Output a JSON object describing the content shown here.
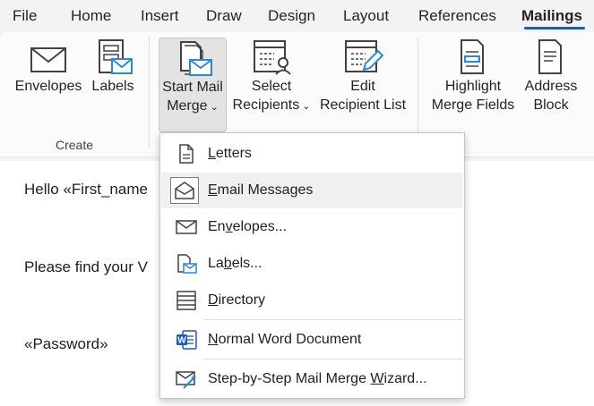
{
  "tabs": [
    {
      "label": "File"
    },
    {
      "label": "Home"
    },
    {
      "label": "Insert"
    },
    {
      "label": "Draw"
    },
    {
      "label": "Design"
    },
    {
      "label": "Layout"
    },
    {
      "label": "References"
    },
    {
      "label": "Mailings",
      "active": true
    }
  ],
  "ribbon": {
    "create_group": {
      "label": "Create",
      "envelopes": "Envelopes",
      "labels": "Labels"
    },
    "start_mail_merge": {
      "line1": "Start Mail",
      "line2": "Merge"
    },
    "select_recipients": {
      "line1": "Select",
      "line2": "Recipients"
    },
    "edit_recipient_list": {
      "line1": "Edit",
      "line2": "Recipient List"
    },
    "highlight_merge_fields": {
      "line1": "Highlight",
      "line2": "Merge Fields"
    },
    "address_block": {
      "line1": "Address",
      "line2": "Block"
    }
  },
  "document": {
    "line1": "Hello «First_name",
    "line2": "Please find your V",
    "line3": "«Password»"
  },
  "menu": {
    "items": [
      {
        "pre": "",
        "key": "L",
        "post": "etters",
        "icon": "letter-document-icon"
      },
      {
        "pre": "",
        "key": "E",
        "post": "mail Messages",
        "icon": "email-envelope-icon",
        "selected": true
      },
      {
        "pre": "En",
        "key": "v",
        "post": "elopes...",
        "icon": "envelope-icon"
      },
      {
        "pre": "La",
        "key": "b",
        "post": "els...",
        "icon": "label-icon"
      },
      {
        "pre": "",
        "key": "D",
        "post": "irectory",
        "icon": "directory-icon"
      },
      {
        "pre": "",
        "key": "N",
        "post": "ormal Word Document",
        "icon": "word-document-icon"
      },
      {
        "pre": "Step-by-Step Mail Merge ",
        "key": "W",
        "post": "izard...",
        "icon": "wizard-icon"
      }
    ]
  },
  "colors": {
    "accent": "#185abd",
    "word_blue": "#185abd",
    "icon_blue": "#2b88d8",
    "icon_gray": "#424242"
  }
}
